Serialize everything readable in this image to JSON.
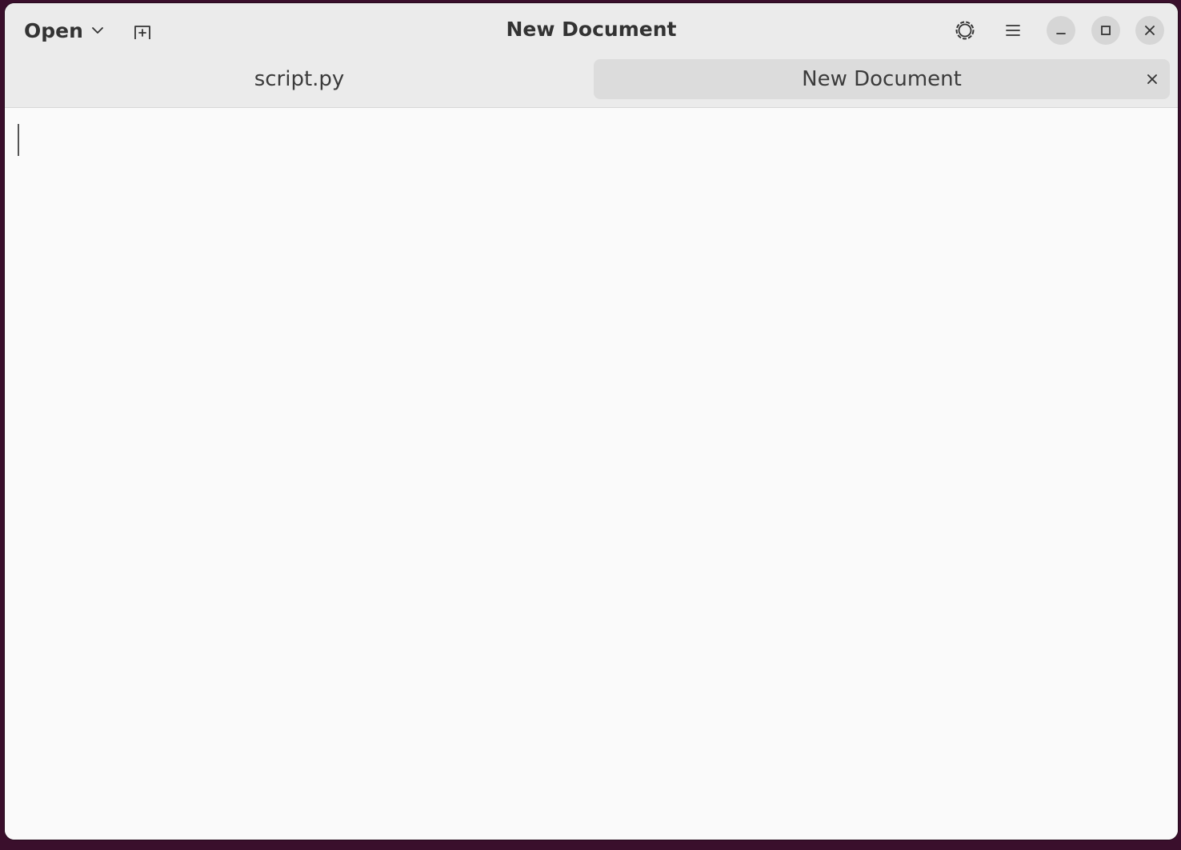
{
  "header": {
    "open_label": "Open",
    "title": "New Document",
    "icons": {
      "open_dropdown": "chevron-down-icon",
      "new_tab": "new-tab-icon",
      "theme": "theme-gear-icon",
      "menu": "hamburger-menu-icon",
      "minimize": "minimize-icon",
      "maximize": "maximize-icon",
      "close": "close-icon"
    }
  },
  "tabs": [
    {
      "label": "script.py",
      "active": false
    },
    {
      "label": "New Document",
      "active": true,
      "close_icon": "close-icon"
    }
  ],
  "editor": {
    "content": ""
  },
  "colors": {
    "headerbar": "#ebebeb",
    "editor_background": "#fafafa",
    "active_tab": "#dcdcdc",
    "window_button": "#d6d6d6",
    "desktop": "#3a0f2c"
  }
}
